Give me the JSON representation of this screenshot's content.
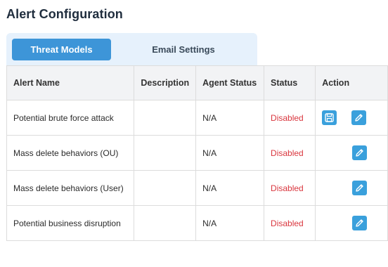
{
  "page": {
    "title": "Alert Configuration"
  },
  "tabs": [
    {
      "label": "Threat Models",
      "active": true
    },
    {
      "label": "Email Settings",
      "active": false
    }
  ],
  "table": {
    "headers": [
      "Alert Name",
      "Description",
      "Agent Status",
      "Status",
      "Action"
    ],
    "rows": [
      {
        "name": "Potential brute force attack",
        "description": "",
        "agent_status": "N/A",
        "status": "Disabled",
        "actions": [
          "save-icon",
          "edit-icon"
        ]
      },
      {
        "name": "Mass delete behaviors (OU)",
        "description": "",
        "agent_status": "N/A",
        "status": "Disabled",
        "actions": [
          "edit-icon"
        ]
      },
      {
        "name": "Mass delete behaviors (User)",
        "description": "",
        "agent_status": "N/A",
        "status": "Disabled",
        "actions": [
          "edit-icon"
        ]
      },
      {
        "name": "Potential business disruption",
        "description": "",
        "agent_status": "N/A",
        "status": "Disabled",
        "actions": [
          "edit-icon"
        ]
      }
    ]
  },
  "colors": {
    "tab_active_bg": "#3d95d8",
    "tab_bar_bg": "#e6f1fc",
    "status_disabled": "#d9363e",
    "action_button": "#3aa0dc"
  }
}
